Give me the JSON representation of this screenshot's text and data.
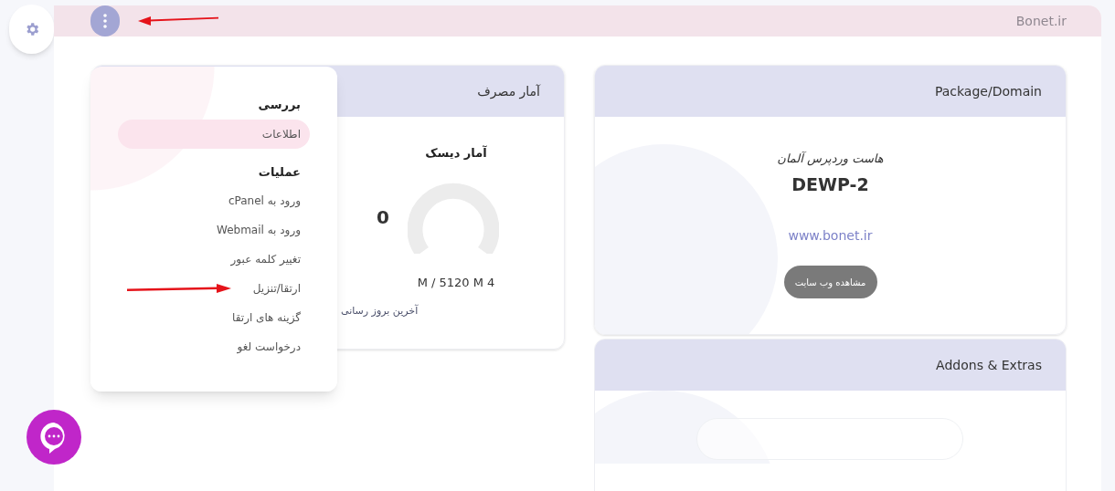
{
  "header": {
    "site_name": "Bonet.ir"
  },
  "menu": {
    "sections": [
      {
        "heading": "بررسی",
        "items": [
          {
            "label": "اطلاعات",
            "selected": true
          }
        ]
      },
      {
        "heading": "عملیات",
        "items": [
          {
            "label": "ورود به cPanel",
            "selected": false
          },
          {
            "label": "ورود به Webmail",
            "selected": false
          },
          {
            "label": "تغییر کلمه عبور",
            "selected": false
          },
          {
            "label": "ارتقا/تنزیل",
            "selected": false
          },
          {
            "label": "گزینه های ارتقا",
            "selected": false
          },
          {
            "label": "درخواست لغو",
            "selected": false
          }
        ]
      }
    ]
  },
  "usage_card": {
    "title": "آمار مصرف",
    "disk_title": "آمار دیسک",
    "value": "0",
    "reading": "M / 5120 M 4",
    "last_update": "آخرین بروز رسانی"
  },
  "package_card": {
    "title": "Package/Domain",
    "product": "هاست وردپرس آلمان",
    "package": "DEWP-2",
    "domain": "www.bonet.ir",
    "button": "مشاهده وب سایت"
  },
  "addons_card": {
    "title": "Addons & Extras"
  }
}
